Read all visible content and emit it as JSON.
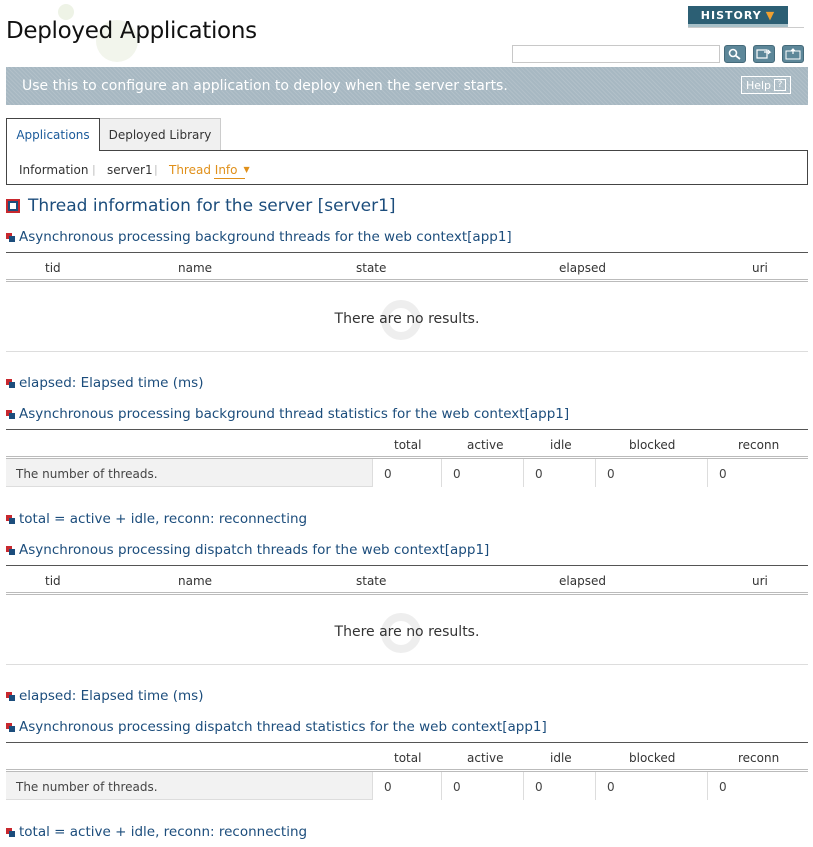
{
  "header": {
    "title": "Deployed Applications",
    "history_label": "HISTORY",
    "search_placeholder": "",
    "help_label": "Help",
    "help_q": "?"
  },
  "banner": {
    "text": "Use this to configure an application to deploy when the server starts."
  },
  "tabs": [
    {
      "label": "Applications"
    },
    {
      "label": "Deployed Library"
    }
  ],
  "subnav": {
    "information": "Information",
    "server": "server1",
    "thread_info": "Thread Info"
  },
  "main_title": "Thread information for the server [server1]",
  "sections": {
    "s1_title": "Asynchronous processing background threads for the web context[app1]",
    "s1_note": "elapsed: Elapsed time (ms)",
    "s2_title": "Asynchronous processing background thread statistics for the web context[app1]",
    "s2_note": "total = active + idle, reconn: reconnecting",
    "s3_title": "Asynchronous processing dispatch threads for the web context[app1]",
    "s3_note": "elapsed: Elapsed time (ms)",
    "s4_title": "Asynchronous processing dispatch thread statistics for the web context[app1]",
    "s4_note": "total = active + idle, reconn: reconnecting"
  },
  "thread_columns": [
    "tid",
    "name",
    "state",
    "elapsed",
    "uri"
  ],
  "stats_columns": [
    "total",
    "active",
    "idle",
    "blocked",
    "reconn"
  ],
  "no_results": "There are no results.",
  "stats_row": {
    "label": "The number of threads.",
    "values": [
      "0",
      "0",
      "0",
      "0",
      "0"
    ]
  },
  "colors": {
    "accent": "#1c4d7c",
    "bullet_red": "#c8282e",
    "banner": "#a7b8c2",
    "thread_info": "#e0901a"
  }
}
